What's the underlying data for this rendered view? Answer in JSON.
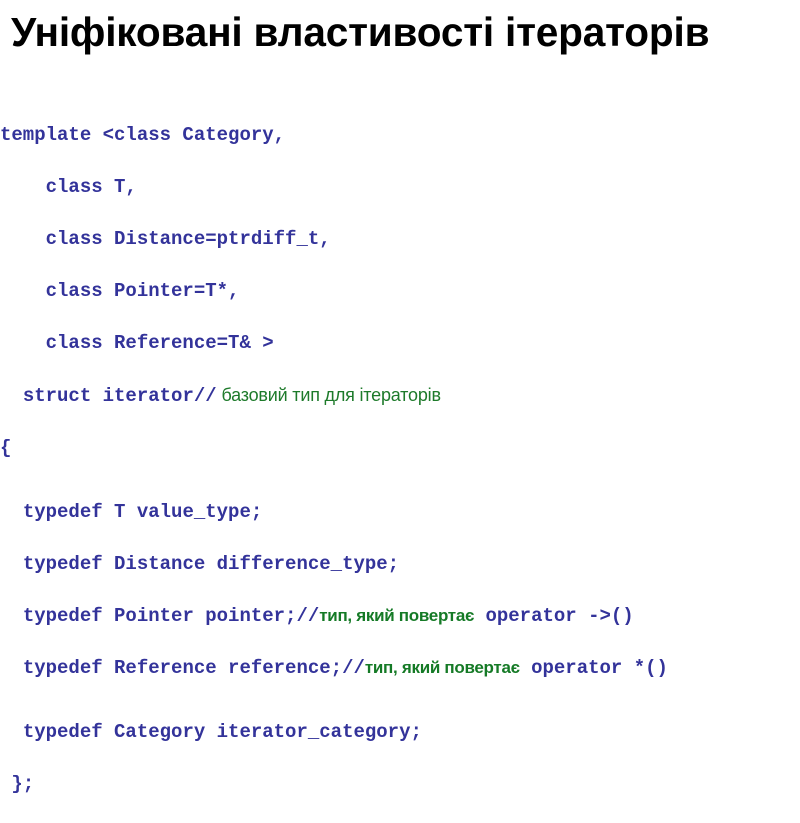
{
  "slide": {
    "title": "Уніфіковані властивості ітераторів",
    "background_color": "#ffffff",
    "title_color": "#000000",
    "code_color": "#33339a",
    "comment_color": "#157a26"
  },
  "code": {
    "lines": [
      {
        "indent": 0,
        "text": "template <class Category,"
      },
      {
        "indent": 4,
        "text": "class T,"
      },
      {
        "indent": 4,
        "text": "class Distance=ptrdiff_t,"
      },
      {
        "indent": 4,
        "text": "class Pointer=T*,"
      },
      {
        "indent": 4,
        "text": "class Reference=T& >"
      },
      {
        "indent": 2,
        "text": "struct iterator//",
        "comment_plain": " базовий тип для ітераторів"
      },
      {
        "indent": 0,
        "text": "{"
      },
      {
        "indent": 2,
        "text": "typedef T value_type;"
      },
      {
        "indent": 2,
        "text": "typedef Distance difference_type;"
      },
      {
        "indent": 2,
        "text": "typedef Pointer pointer;//",
        "comment_bold": "тип, який повертає",
        "tail": " operator ->()"
      },
      {
        "indent": 2,
        "text": "typedef Reference reference;//",
        "comment_bold": "тип, який повертає",
        "tail": " operator *()"
      },
      {
        "indent": 2,
        "text": "typedef Category iterator_category;"
      },
      {
        "indent": 1,
        "text": "};"
      }
    ]
  }
}
